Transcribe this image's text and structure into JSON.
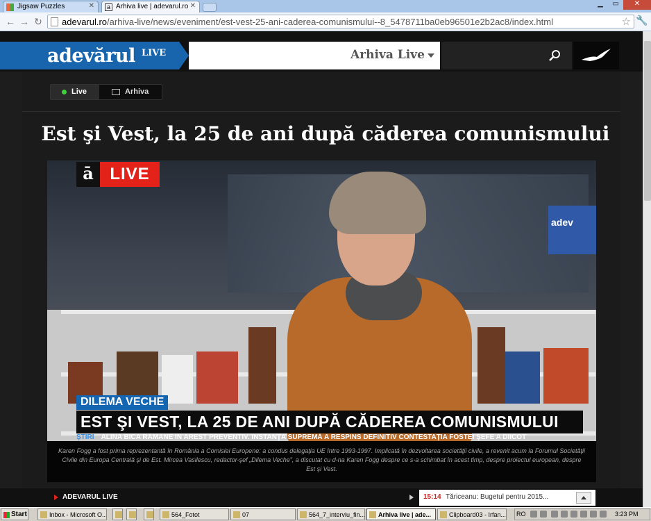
{
  "browser": {
    "tabs": [
      {
        "label": "Jigsaw Puzzles",
        "active": false
      },
      {
        "label": "Arhiva live | adevarul.ro",
        "active": true
      }
    ],
    "url_domain": "adevarul.ro",
    "url_path": "/arhiva-live/news/eveniment/est-vest-25-ani-caderea-comunismului--8_5478711ba0eb96501e2b2ac8/index.html"
  },
  "header": {
    "logo": "adevărul",
    "logo_suffix": "LIVE",
    "menu_label": "Arhiva Live",
    "search_value": ""
  },
  "mode_switch": {
    "live_label": "Live",
    "archive_label": "Arhiva"
  },
  "article": {
    "title": "Est şi Vest, la 25 de ani după căderea comunismului"
  },
  "video": {
    "badge_letter": "ā",
    "badge_label": "LIVE",
    "screen_logo": "adev",
    "lower_tag": "DILEMA VECHE",
    "lower_title": "EST ŞI VEST, LA 25 DE ANI DUPĂ CĂDEREA COMUNISMULUI",
    "ticker_label": "ŞTIRI",
    "ticker_text": "ALINA BICA RĂMÂNE ÎN AREST PREVENTIV. INSTANŢA SUPREMĂ A RESPINS DEFINITIV CONTESTAŢIA FOSTEI ŞEFE A DIICOT",
    "caption": "Karen Fogg a fost prima reprezentantă în România a Comisiei Europene: a condus delegaţia UE între 1993-1997. Implicată în dezvoltarea societăţii civile, a revenit acum la Forumul Societăţii Civile din Europa Centrală şi de Est. Mircea Vasilescu, redactor-şef „Dilema Veche”, a discutat cu d-na Karen Fogg despre ce s-a schimbat în acest timp, despre proiectul european, despre Est şi Vest."
  },
  "live_bar": {
    "label": "ADEVARUL LIVE",
    "news_time": "15:14",
    "news_text": "Tăriceanu: Bugetul pentru 2015..."
  },
  "taskbar": {
    "start_label": "Start",
    "items": [
      {
        "label": "Inbox - Microsoft O..."
      },
      {
        "label": "564_Fotot"
      },
      {
        "label": "07"
      },
      {
        "label": "564_7_interviu_fin..."
      },
      {
        "label": "Arhiva live | ade...",
        "active": true
      },
      {
        "label": "Clipboard03 - Irfan..."
      }
    ],
    "lang": "RO",
    "clock": "3:23 PM"
  },
  "colors": {
    "brand_blue": "#1965ad",
    "live_red": "#e32219",
    "live_dot": "#3ed13e"
  }
}
